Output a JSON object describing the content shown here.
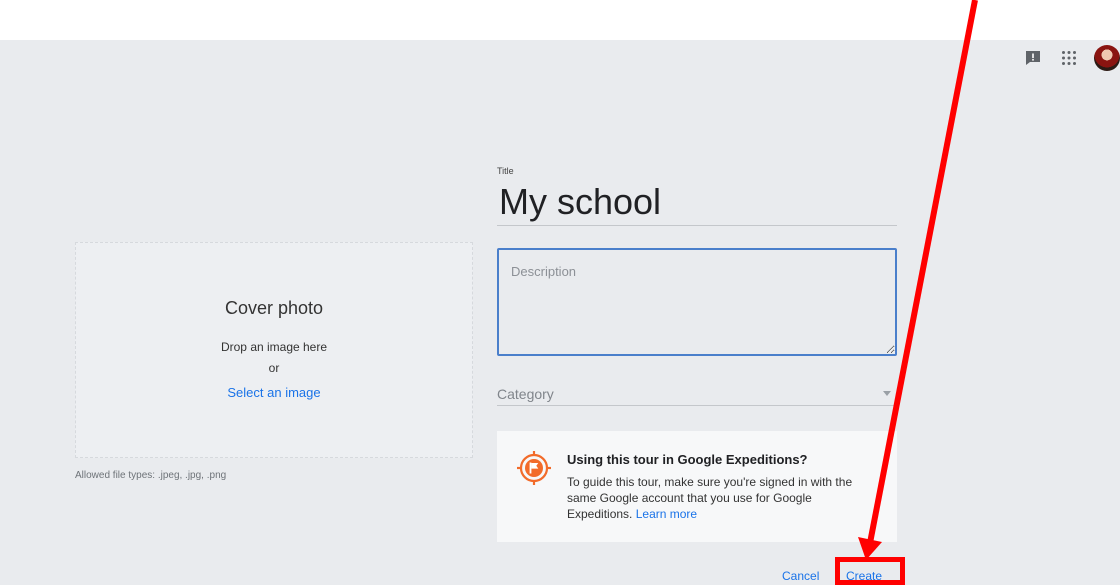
{
  "cover_photo": {
    "title": "Cover photo",
    "drop_text": "Drop an image here",
    "or_text": "or",
    "select_link": "Select an image",
    "allowed_types": "Allowed file types: .jpeg, .jpg, .png"
  },
  "form": {
    "title_label": "Title",
    "title_value": "My school",
    "description_placeholder": "Description",
    "category_placeholder": "Category"
  },
  "expeditions_info": {
    "heading": "Using this tour in Google Expeditions?",
    "body": "To guide this tour, make sure you're signed in with the same Google account that you use for Google Expeditions.",
    "link": "Learn more"
  },
  "actions": {
    "cancel_label": "Cancel",
    "create_label": "Create"
  },
  "header_icons": [
    "feedback-icon",
    "apps-grid-icon",
    "account-avatar"
  ],
  "annotation": {
    "color": "#ff0000",
    "target": "create-button"
  },
  "colors": {
    "accent": "#1a73e8",
    "focus_border": "#4a7fcb",
    "background": "#e9ebee",
    "info_icon": "#f26b2a"
  }
}
